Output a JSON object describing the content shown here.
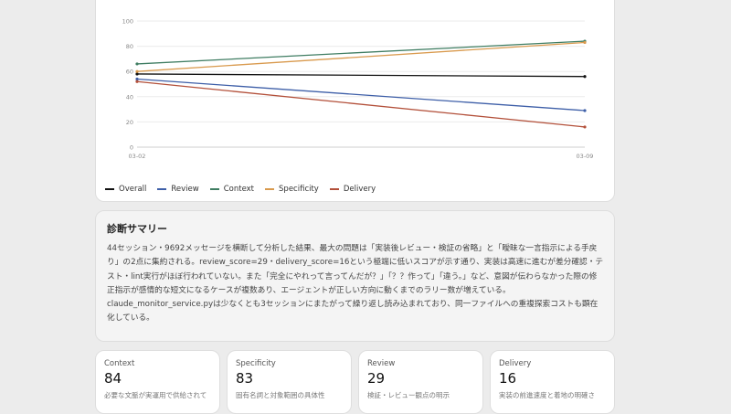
{
  "chart_data": {
    "type": "line",
    "x": [
      "03-02",
      "03-09"
    ],
    "ylim": [
      0,
      100
    ],
    "yticks": [
      0,
      20,
      40,
      60,
      80,
      100
    ],
    "grid": true,
    "legend_position": "bottom-left",
    "series": [
      {
        "name": "Overall",
        "color": "#111111",
        "values": [
          58,
          56
        ]
      },
      {
        "name": "Review",
        "color": "#3e5fa8",
        "values": [
          54,
          29
        ]
      },
      {
        "name": "Context",
        "color": "#3f7d62",
        "values": [
          66,
          84
        ]
      },
      {
        "name": "Specificity",
        "color": "#d99a4e",
        "values": [
          60,
          83
        ]
      },
      {
        "name": "Delivery",
        "color": "#b3503a",
        "values": [
          52,
          16
        ]
      }
    ]
  },
  "summary": {
    "title": "診断サマリー",
    "body": "44セッション・9692メッセージを横断して分析した結果、最大の問題は「実装後レビュー・検証の省略」と「曖昧な一言指示による手戻り」の2点に集約される。review_score=29・delivery_score=16という極端に低いスコアが示す通り、実装は高速に進むが差分確認・テスト・lint実行がほぼ行われていない。また「完全にやれって言ってんだが？」「？？作って」「違う。」など、意図が伝わらなかった際の修正指示が感情的な短文になるケースが複数あり、エージェントが正しい方向に動くまでのラリー数が増えている。claude_monitor_service.pyは少なくとも3セッションにまたがって繰り返し読み込まれており、同一ファイルへの重複探索コストも顕在化している。"
  },
  "metrics": [
    {
      "label": "Context",
      "value": "84",
      "desc": "必要な文脈が実運用で供給されて"
    },
    {
      "label": "Specificity",
      "value": "83",
      "desc": "固有名詞と対象範囲の具体性"
    },
    {
      "label": "Review",
      "value": "29",
      "desc": "検証・レビュー観点の明示"
    },
    {
      "label": "Delivery",
      "value": "16",
      "desc": "実装の前進速度と着地の明確さ"
    }
  ]
}
